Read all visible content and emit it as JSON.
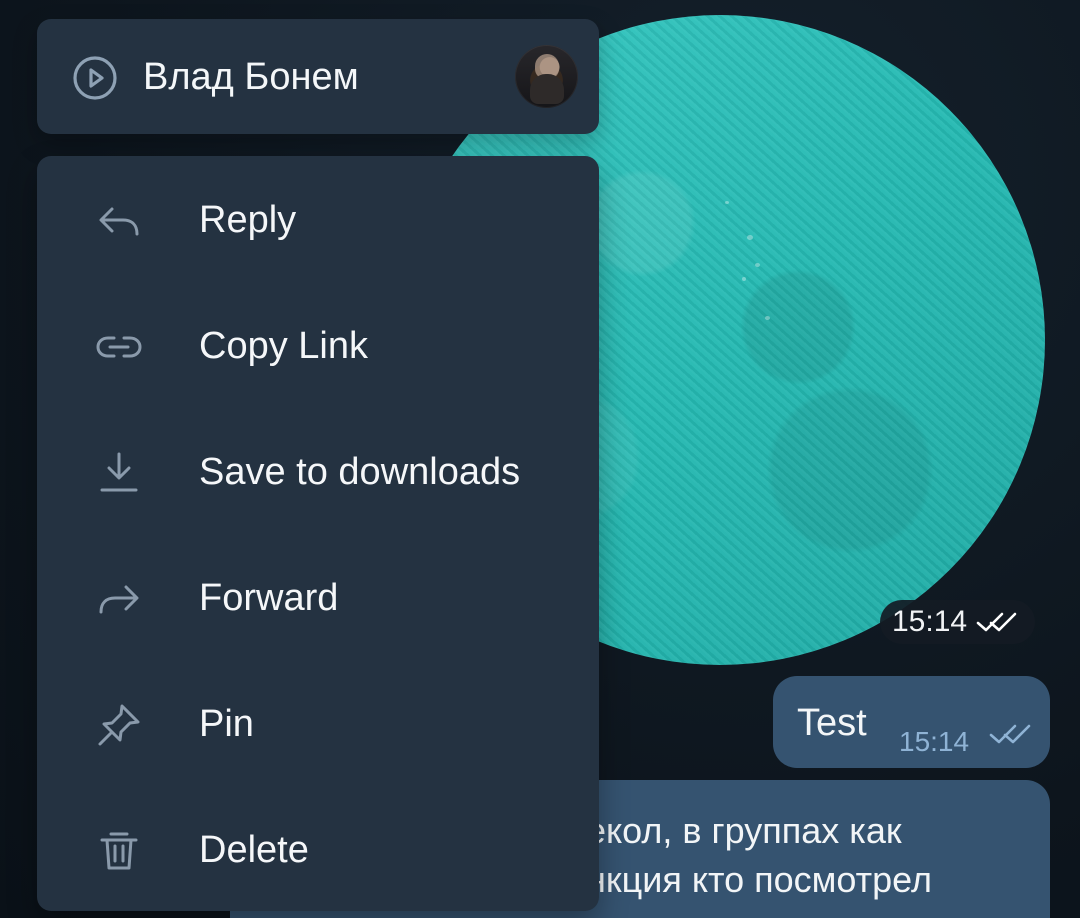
{
  "colors": {
    "background": "#0f1821",
    "panel": "#243241",
    "video_teal": "#29bdb6",
    "bubble": "#355370",
    "tick_blue": "#8fb3d5",
    "text": "#f5f7f9"
  },
  "sender": {
    "name": "Влад Бонем",
    "play_icon": "play-circle-icon",
    "avatar_label": "avatar"
  },
  "menu": {
    "items": [
      {
        "label": "Reply",
        "icon": "reply-icon"
      },
      {
        "label": "Copy Link",
        "icon": "link-icon"
      },
      {
        "label": "Save to downloads",
        "icon": "download-icon"
      },
      {
        "label": "Forward",
        "icon": "forward-icon"
      },
      {
        "label": "Pin",
        "icon": "pin-icon"
      },
      {
        "label": "Delete",
        "icon": "delete-icon"
      }
    ]
  },
  "messages": {
    "video_time": "15:14",
    "test_text": "Test",
    "test_time": "15:14",
    "long_line_1": "екол, в группах как",
    "long_line_2": "нкция кто посмотрел"
  }
}
